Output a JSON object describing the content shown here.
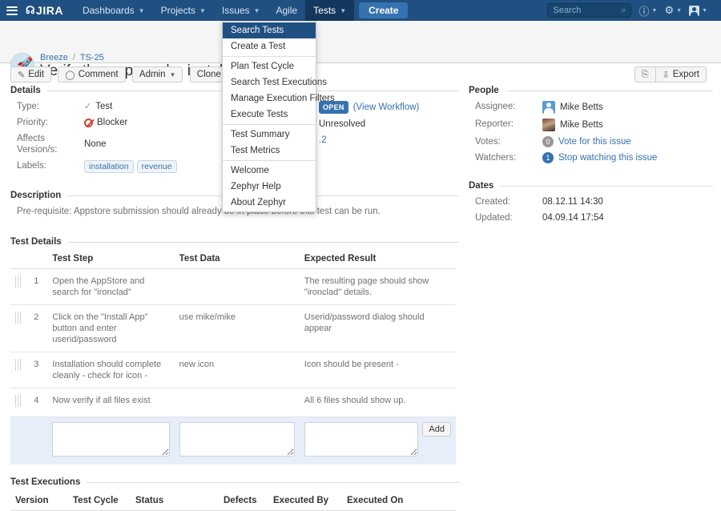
{
  "topnav": {
    "brand": "JIRA",
    "items": [
      {
        "label": "Dashboards",
        "caret": true,
        "active": false
      },
      {
        "label": "Projects",
        "caret": true,
        "active": false
      },
      {
        "label": "Issues",
        "caret": true,
        "active": false
      },
      {
        "label": "Agile",
        "caret": false,
        "active": false
      },
      {
        "label": "Tests",
        "caret": true,
        "active": true
      }
    ],
    "create_label": "Create",
    "search_placeholder": "Search",
    "search_value": ""
  },
  "tests_dropdown": {
    "groups": [
      [
        {
          "label": "Search Tests",
          "selected": true
        },
        {
          "label": "Create a Test",
          "selected": false
        }
      ],
      [
        {
          "label": "Plan Test Cycle",
          "selected": false
        },
        {
          "label": "Search Test Executions",
          "selected": false
        },
        {
          "label": "Manage Execution Filters",
          "selected": false
        },
        {
          "label": "Execute Tests",
          "selected": false
        }
      ],
      [
        {
          "label": "Test Summary",
          "selected": false
        },
        {
          "label": "Test Metrics",
          "selected": false
        }
      ],
      [
        {
          "label": "Welcome",
          "selected": false
        },
        {
          "label": "Zephyr Help",
          "selected": false
        },
        {
          "label": "About Zephyr",
          "selected": false
        }
      ]
    ]
  },
  "header": {
    "project": "Breeze",
    "issue_key": "TS-25",
    "title": "Verify the app can be installed from"
  },
  "toolbar": {
    "edit_label": "Edit",
    "comment_label": "Comment",
    "admin_label": "Admin",
    "clone_label": "Clone",
    "more_actions_label": "More Actions",
    "export_label": "Export"
  },
  "details": {
    "heading": "Details",
    "type_label": "Type:",
    "type_value": "Test",
    "priority_label": "Priority:",
    "priority_value": "Blocker",
    "affects_label": "Affects Version/s:",
    "affects_value": "None",
    "labels_label": "Labels:",
    "labels": [
      "installation",
      "revenue"
    ],
    "status_badge": "OPEN",
    "status_link": "(View Workflow)",
    "resolution_value": "Unresolved",
    "fix_version_value": ".2"
  },
  "people": {
    "heading": "People",
    "assignee_label": "Assignee:",
    "assignee_value": "Mike Betts",
    "reporter_label": "Reporter:",
    "reporter_value": "Mike Betts",
    "votes_label": "Votes:",
    "votes_count": "0",
    "votes_link": "Vote for this issue",
    "watchers_label": "Watchers:",
    "watchers_count": "1",
    "watchers_link": "Stop watching this issue"
  },
  "dates": {
    "heading": "Dates",
    "created_label": "Created:",
    "created_value": "08.12.11 14:30",
    "updated_label": "Updated:",
    "updated_value": "04.09.14 17:54"
  },
  "description": {
    "heading": "Description",
    "text": "Pre-requisite: Appstore submission should already be in place before this test can be run."
  },
  "test_details": {
    "heading": "Test Details",
    "columns": [
      "",
      "",
      "Test Step",
      "Test Data",
      "Expected Result"
    ],
    "rows": [
      {
        "num": "1",
        "step": "Open the AppStore and search for \"ironclad\"",
        "data": "",
        "result": "The resulting page should show \"ironclad\" details."
      },
      {
        "num": "2",
        "step": "Click on the \"Install App\" button and enter userid/password",
        "data": "use mike/mike",
        "result": "Userid/password dialog should appear"
      },
      {
        "num": "3",
        "step": "Installation should complete cleanly - check for icon -",
        "data": "new icon",
        "result": "Icon should be present -"
      },
      {
        "num": "4",
        "step": "Now verify if all files exist",
        "data": "",
        "result": "All 6 files should show up."
      }
    ],
    "add_row": {
      "step_value": "",
      "data_value": "",
      "result_value": "",
      "add_label": "Add"
    }
  },
  "test_executions": {
    "heading": "Test Executions",
    "columns": [
      "Version",
      "Test Cycle",
      "Status",
      "Defects",
      "Executed By",
      "Executed On"
    ]
  },
  "colors": {
    "nav_bg": "#205081",
    "nav_active": "#14385d",
    "create_btn": "#3572b0",
    "link": "#3572b0",
    "priority": "#d04437",
    "type": "#5cb85c",
    "add_row_bg": "#e7eefa"
  }
}
